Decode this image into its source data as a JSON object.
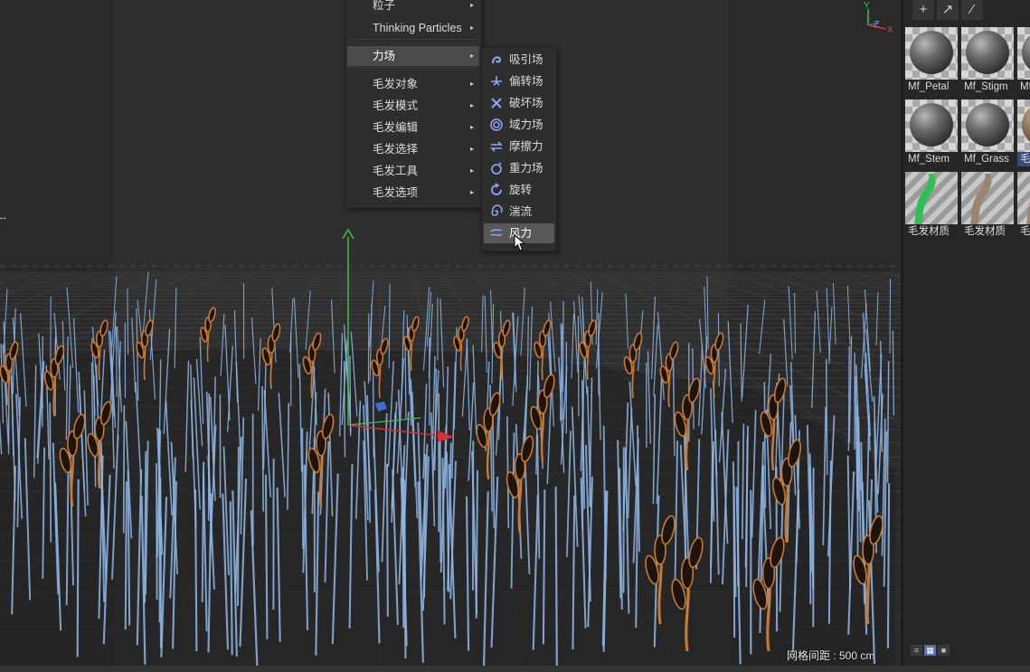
{
  "viewport": {
    "grid_spacing_label": "网格间距 : 500 cm",
    "axis_labels": {
      "y": "Y",
      "z": "Z",
      "x": "X"
    }
  },
  "menu": {
    "items": [
      {
        "label": "粒子",
        "has_submenu": true
      },
      {
        "label": "Thinking Particles",
        "has_submenu": true
      },
      {
        "label": "力场",
        "has_submenu": true,
        "highlighted": true
      },
      {
        "label": "毛发对象",
        "has_submenu": true
      },
      {
        "label": "毛发模式",
        "has_submenu": true
      },
      {
        "label": "毛发编辑",
        "has_submenu": true
      },
      {
        "label": "毛发选择",
        "has_submenu": true
      },
      {
        "label": "毛发工具",
        "has_submenu": true
      },
      {
        "label": "毛发选项",
        "has_submenu": true
      }
    ],
    "submenu_arrow": "▸"
  },
  "submenu": {
    "items": [
      {
        "label": "吸引场",
        "icon": "attractor-icon"
      },
      {
        "label": "偏转场",
        "icon": "deflector-icon"
      },
      {
        "label": "破坏场",
        "icon": "destructor-icon"
      },
      {
        "label": "域力场",
        "icon": "field-force-icon"
      },
      {
        "label": "摩擦力",
        "icon": "friction-icon"
      },
      {
        "label": "重力场",
        "icon": "gravity-icon"
      },
      {
        "label": "旋转",
        "icon": "rotation-icon"
      },
      {
        "label": "湍流",
        "icon": "turbulence-icon"
      },
      {
        "label": "风力",
        "icon": "wind-icon",
        "hovered": true
      }
    ]
  },
  "material_panel": {
    "toolbar": [
      {
        "icon": "add-icon",
        "glyph": "+"
      },
      {
        "icon": "arrow-icon",
        "glyph": "↗"
      },
      {
        "icon": "eyedropper-icon",
        "glyph": "⁄"
      }
    ],
    "materials": [
      {
        "name": "Mf_Petal",
        "preview": "gray-sphere"
      },
      {
        "name": "Mf_Stigm",
        "preview": "gray-sphere"
      },
      {
        "name": "Mf",
        "preview": "gray-sphere"
      },
      {
        "name": "Mf_Stem",
        "preview": "gray-sphere"
      },
      {
        "name": "Mf_Grass",
        "preview": "gray-sphere"
      },
      {
        "name": "毛",
        "preview": "tan-sphere",
        "selected": true
      },
      {
        "name": "毛发材质",
        "preview": "green-blade"
      },
      {
        "name": "毛发材质",
        "preview": "brown-blade"
      },
      {
        "name": "毛",
        "preview": "brown-blade"
      }
    ],
    "view_modes": [
      {
        "icon": "list-view-icon",
        "glyph": "≡"
      },
      {
        "icon": "grid-view-icon",
        "glyph": "▦",
        "active": true
      },
      {
        "icon": "large-view-icon",
        "glyph": "■"
      }
    ]
  },
  "colors": {
    "hair_strand": "#8fb7e6",
    "plant_fill": "#1c140d",
    "plant_outline": "#c77a33",
    "axis_y": "#3fbf4f",
    "axis_x": "#d4303a",
    "axis_z": "#3a6fd0"
  }
}
